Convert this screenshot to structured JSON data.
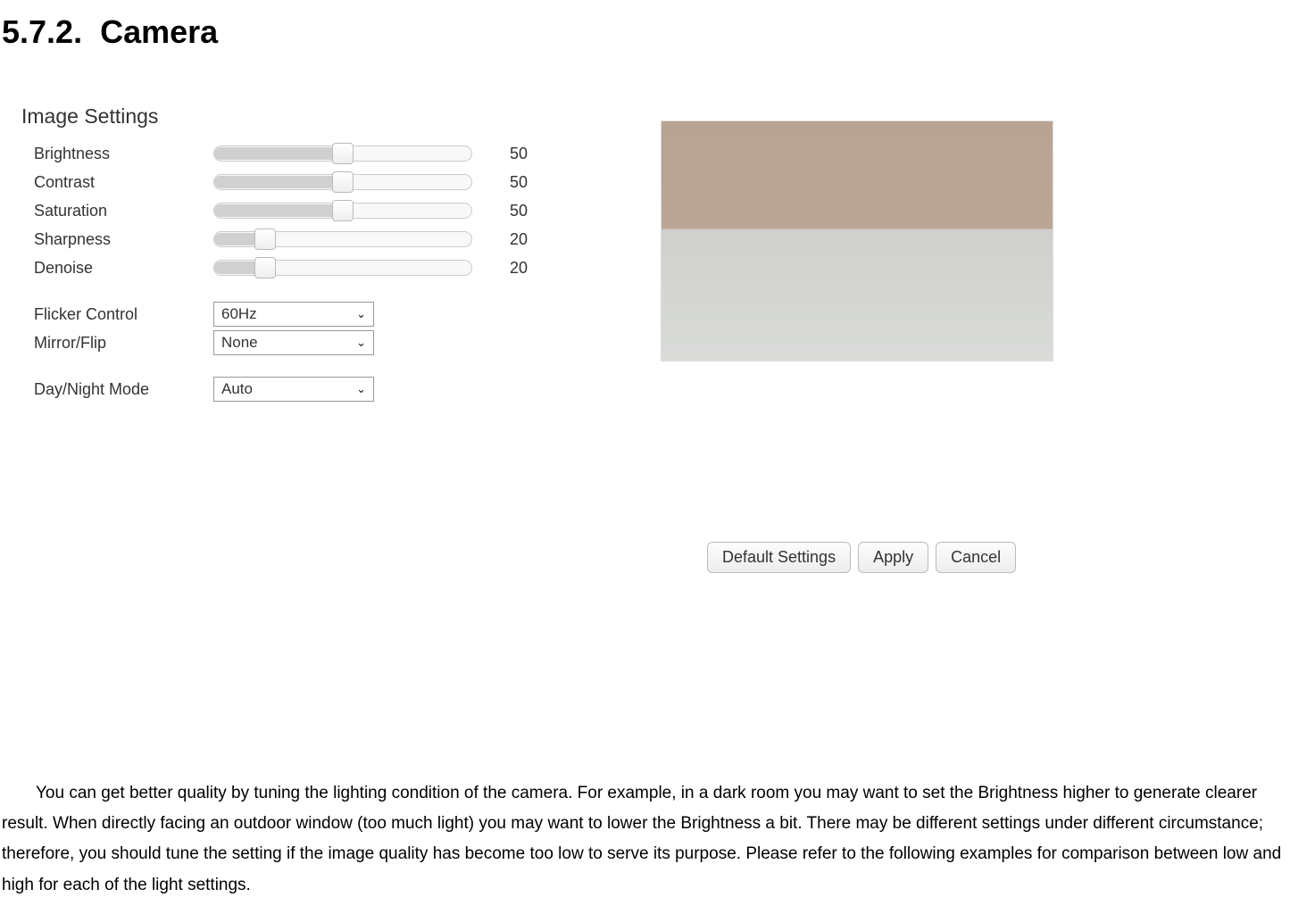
{
  "doc": {
    "section_number": "5.7.2.",
    "section_title": "Camera",
    "body": "You can get better quality by tuning the lighting condition of the camera. For example, in a dark room you may want to set the Brightness higher to generate clearer result. When directly facing an outdoor window (too much light) you may want to lower the Brightness a bit. There may be different settings under different circumstance; therefore, you should tune the setting if the image quality has become too low to serve its purpose. Please refer to the following examples for comparison between low and high for each of the light settings."
  },
  "panel": {
    "title": "Image Settings",
    "sliders": {
      "brightness": {
        "label": "Brightness",
        "value": "50",
        "pct": 50
      },
      "contrast": {
        "label": "Contrast",
        "value": "50",
        "pct": 50
      },
      "saturation": {
        "label": "Saturation",
        "value": "50",
        "pct": 50
      },
      "sharpness": {
        "label": "Sharpness",
        "value": "20",
        "pct": 20
      },
      "denoise": {
        "label": "Denoise",
        "value": "20",
        "pct": 20
      }
    },
    "selects": {
      "flicker": {
        "label": "Flicker Control",
        "value": "60Hz"
      },
      "mirror": {
        "label": "Mirror/Flip",
        "value": "None"
      },
      "daynight": {
        "label": "Day/Night Mode",
        "value": "Auto"
      }
    },
    "buttons": {
      "default": "Default Settings",
      "apply": "Apply",
      "cancel": "Cancel"
    }
  }
}
